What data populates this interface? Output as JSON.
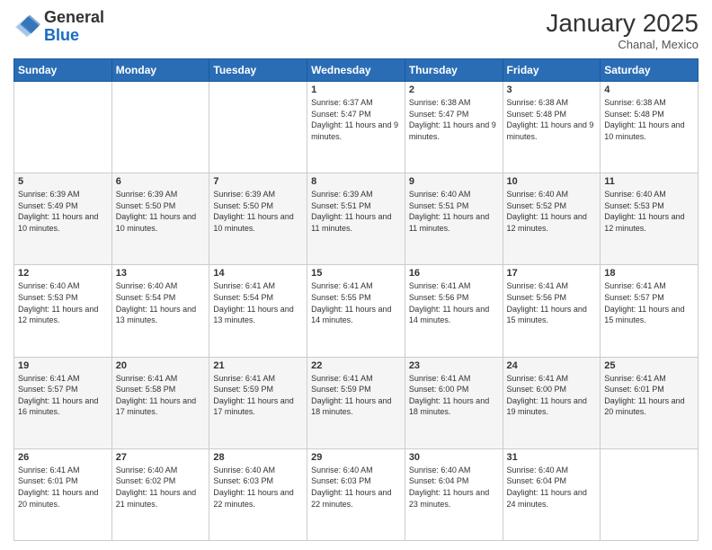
{
  "header": {
    "logo": {
      "general": "General",
      "blue": "Blue"
    },
    "title": "January 2025",
    "location": "Chanal, Mexico"
  },
  "weekdays": [
    "Sunday",
    "Monday",
    "Tuesday",
    "Wednesday",
    "Thursday",
    "Friday",
    "Saturday"
  ],
  "weeks": [
    [
      {
        "day": "",
        "info": ""
      },
      {
        "day": "",
        "info": ""
      },
      {
        "day": "",
        "info": ""
      },
      {
        "day": "1",
        "info": "Sunrise: 6:37 AM\nSunset: 5:47 PM\nDaylight: 11 hours\nand 9 minutes."
      },
      {
        "day": "2",
        "info": "Sunrise: 6:38 AM\nSunset: 5:47 PM\nDaylight: 11 hours\nand 9 minutes."
      },
      {
        "day": "3",
        "info": "Sunrise: 6:38 AM\nSunset: 5:48 PM\nDaylight: 11 hours\nand 9 minutes."
      },
      {
        "day": "4",
        "info": "Sunrise: 6:38 AM\nSunset: 5:48 PM\nDaylight: 11 hours\nand 10 minutes."
      }
    ],
    [
      {
        "day": "5",
        "info": "Sunrise: 6:39 AM\nSunset: 5:49 PM\nDaylight: 11 hours\nand 10 minutes."
      },
      {
        "day": "6",
        "info": "Sunrise: 6:39 AM\nSunset: 5:50 PM\nDaylight: 11 hours\nand 10 minutes."
      },
      {
        "day": "7",
        "info": "Sunrise: 6:39 AM\nSunset: 5:50 PM\nDaylight: 11 hours\nand 10 minutes."
      },
      {
        "day": "8",
        "info": "Sunrise: 6:39 AM\nSunset: 5:51 PM\nDaylight: 11 hours\nand 11 minutes."
      },
      {
        "day": "9",
        "info": "Sunrise: 6:40 AM\nSunset: 5:51 PM\nDaylight: 11 hours\nand 11 minutes."
      },
      {
        "day": "10",
        "info": "Sunrise: 6:40 AM\nSunset: 5:52 PM\nDaylight: 11 hours\nand 12 minutes."
      },
      {
        "day": "11",
        "info": "Sunrise: 6:40 AM\nSunset: 5:53 PM\nDaylight: 11 hours\nand 12 minutes."
      }
    ],
    [
      {
        "day": "12",
        "info": "Sunrise: 6:40 AM\nSunset: 5:53 PM\nDaylight: 11 hours\nand 12 minutes."
      },
      {
        "day": "13",
        "info": "Sunrise: 6:40 AM\nSunset: 5:54 PM\nDaylight: 11 hours\nand 13 minutes."
      },
      {
        "day": "14",
        "info": "Sunrise: 6:41 AM\nSunset: 5:54 PM\nDaylight: 11 hours\nand 13 minutes."
      },
      {
        "day": "15",
        "info": "Sunrise: 6:41 AM\nSunset: 5:55 PM\nDaylight: 11 hours\nand 14 minutes."
      },
      {
        "day": "16",
        "info": "Sunrise: 6:41 AM\nSunset: 5:56 PM\nDaylight: 11 hours\nand 14 minutes."
      },
      {
        "day": "17",
        "info": "Sunrise: 6:41 AM\nSunset: 5:56 PM\nDaylight: 11 hours\nand 15 minutes."
      },
      {
        "day": "18",
        "info": "Sunrise: 6:41 AM\nSunset: 5:57 PM\nDaylight: 11 hours\nand 15 minutes."
      }
    ],
    [
      {
        "day": "19",
        "info": "Sunrise: 6:41 AM\nSunset: 5:57 PM\nDaylight: 11 hours\nand 16 minutes."
      },
      {
        "day": "20",
        "info": "Sunrise: 6:41 AM\nSunset: 5:58 PM\nDaylight: 11 hours\nand 17 minutes."
      },
      {
        "day": "21",
        "info": "Sunrise: 6:41 AM\nSunset: 5:59 PM\nDaylight: 11 hours\nand 17 minutes."
      },
      {
        "day": "22",
        "info": "Sunrise: 6:41 AM\nSunset: 5:59 PM\nDaylight: 11 hours\nand 18 minutes."
      },
      {
        "day": "23",
        "info": "Sunrise: 6:41 AM\nSunset: 6:00 PM\nDaylight: 11 hours\nand 18 minutes."
      },
      {
        "day": "24",
        "info": "Sunrise: 6:41 AM\nSunset: 6:00 PM\nDaylight: 11 hours\nand 19 minutes."
      },
      {
        "day": "25",
        "info": "Sunrise: 6:41 AM\nSunset: 6:01 PM\nDaylight: 11 hours\nand 20 minutes."
      }
    ],
    [
      {
        "day": "26",
        "info": "Sunrise: 6:41 AM\nSunset: 6:01 PM\nDaylight: 11 hours\nand 20 minutes."
      },
      {
        "day": "27",
        "info": "Sunrise: 6:40 AM\nSunset: 6:02 PM\nDaylight: 11 hours\nand 21 minutes."
      },
      {
        "day": "28",
        "info": "Sunrise: 6:40 AM\nSunset: 6:03 PM\nDaylight: 11 hours\nand 22 minutes."
      },
      {
        "day": "29",
        "info": "Sunrise: 6:40 AM\nSunset: 6:03 PM\nDaylight: 11 hours\nand 22 minutes."
      },
      {
        "day": "30",
        "info": "Sunrise: 6:40 AM\nSunset: 6:04 PM\nDaylight: 11 hours\nand 23 minutes."
      },
      {
        "day": "31",
        "info": "Sunrise: 6:40 AM\nSunset: 6:04 PM\nDaylight: 11 hours\nand 24 minutes."
      },
      {
        "day": "",
        "info": ""
      }
    ]
  ]
}
